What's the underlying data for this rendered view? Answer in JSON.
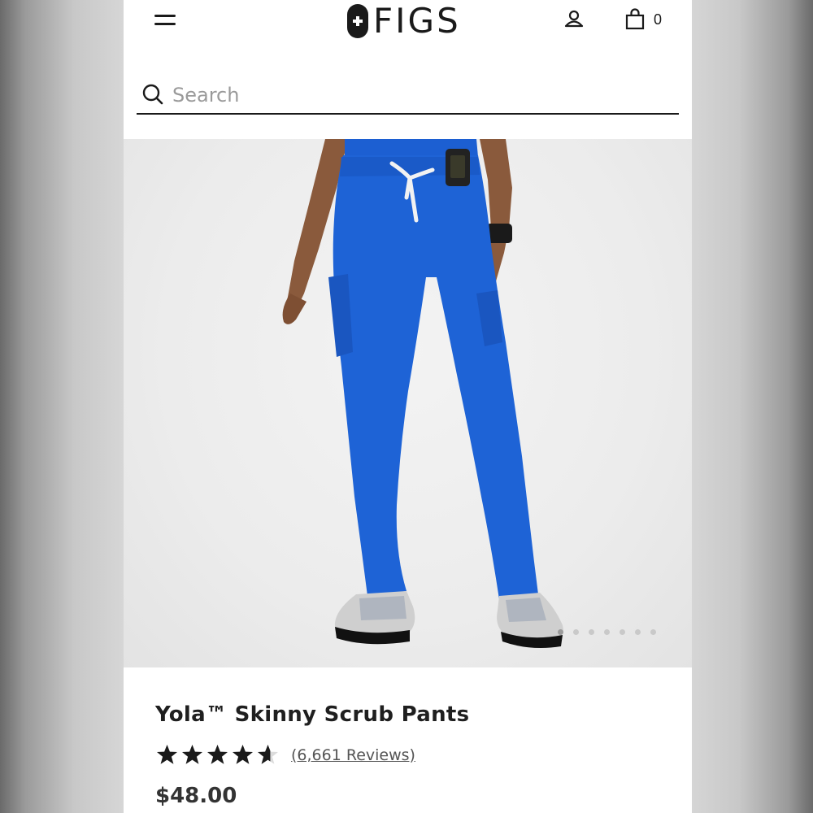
{
  "colors": {
    "brand": "#1a1a1a",
    "scrub_blue": "#1e63d6",
    "background": "#ffffff"
  },
  "header": {
    "logo_text": "FIGS",
    "menu_icon": "hamburger-menu-icon",
    "account_icon": "user-icon",
    "cart_icon": "shopping-bag-icon",
    "cart_count": "0"
  },
  "search": {
    "placeholder": "Search",
    "value": "",
    "icon": "search-icon"
  },
  "gallery": {
    "image_count": 7,
    "active_index": 0
  },
  "product": {
    "title": "Yola™ Skinny Scrub Pants",
    "rating": 4.6,
    "rating_max": 5,
    "reviews_text": "(6,661 Reviews)",
    "price": "$48.00"
  }
}
